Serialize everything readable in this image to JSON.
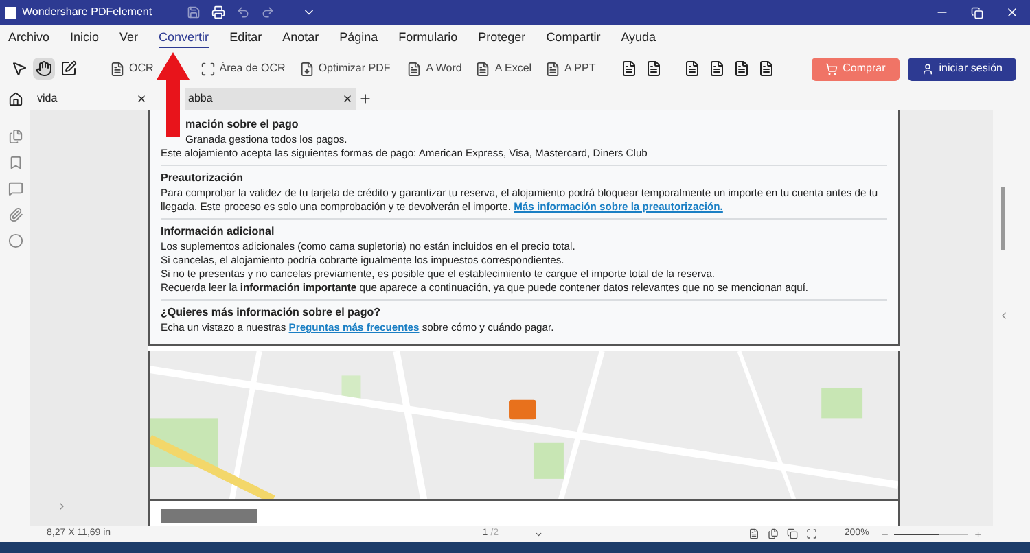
{
  "window": {
    "title": "Wondershare PDFelement"
  },
  "menu": [
    {
      "label": "Archivo",
      "selected": false
    },
    {
      "label": "Inicio",
      "selected": false
    },
    {
      "label": "Ver",
      "selected": false
    },
    {
      "label": "Convertir",
      "selected": true
    },
    {
      "label": "Editar",
      "selected": false
    },
    {
      "label": "Anotar",
      "selected": false
    },
    {
      "label": "Página",
      "selected": false
    },
    {
      "label": "Formulario",
      "selected": false
    },
    {
      "label": "Proteger",
      "selected": false
    },
    {
      "label": "Compartir",
      "selected": false
    },
    {
      "label": "Ayuda",
      "selected": false
    }
  ],
  "tools": [
    {
      "kind": "select",
      "selected": false
    },
    {
      "kind": "hand",
      "selected": true
    },
    {
      "kind": "edit",
      "selected": false
    }
  ],
  "actions": [
    {
      "kind": "ocr",
      "label": "OCR"
    },
    {
      "kind": "area",
      "label": "Área de OCR"
    },
    {
      "kind": "optimize",
      "label": "Optimizar PDF"
    },
    {
      "kind": "word",
      "label": "A Word"
    },
    {
      "kind": "excel",
      "label": "A Excel"
    },
    {
      "kind": "ppt",
      "label": "A PPT"
    }
  ],
  "buttons": {
    "buy": "Comprar",
    "login": "iniciar sesión"
  },
  "tabs": [
    {
      "label": "vida",
      "selected": false
    },
    {
      "label": "abba",
      "selected": true
    }
  ],
  "document": {
    "sections": [
      {
        "heading": "mación sobre el pago",
        "paragraphs": [
          [
            {
              "kind": "text",
              "text": "Granada gestiona todos los pagos."
            }
          ],
          [
            {
              "kind": "text",
              "text": "Este alojamiento acepta las siguientes formas de pago: American Express, Visa, Mastercard, Diners Club"
            }
          ]
        ]
      },
      {
        "heading": "Preautorización",
        "paragraphs": [
          [
            {
              "kind": "text",
              "text": "Para comprobar la validez de tu tarjeta de crédito y garantizar tu reserva, el alojamiento podrá bloquear temporalmente un importe en tu cuenta antes de tu llegada. Este proceso es solo una comprobación y te devolverán el importe. "
            },
            {
              "kind": "link",
              "text": "Más información sobre la preautorización."
            }
          ]
        ]
      },
      {
        "heading": "Información adicional",
        "paragraphs": [
          [
            {
              "kind": "text",
              "text": "Los suplementos adicionales (como cama supletoria) no están incluidos en el precio total."
            }
          ],
          [
            {
              "kind": "text",
              "text": "Si cancelas, el alojamiento podría cobrarte igualmente los impuestos correspondientes."
            }
          ],
          [
            {
              "kind": "text",
              "text": "Si no te presentas y no cancelas previamente, es posible que el establecimiento te cargue el importe total de la reserva."
            }
          ],
          [
            {
              "kind": "text",
              "text": "Recuerda leer la **información importante** que aparece a continuación, ya que puede contener datos relevantes que no se mencionan aquí."
            }
          ]
        ]
      },
      {
        "heading": "¿Quieres más información sobre el pago?",
        "paragraphs": [
          [
            {
              "kind": "text",
              "text": "Echa un vistazo a nuestras "
            },
            {
              "kind": "link",
              "text": "Preguntas más frecuentes"
            },
            {
              "kind": "text",
              "text": " sobre cómo y cuándo pagar."
            }
          ]
        ]
      }
    ]
  },
  "status": {
    "page_size": "8,27 X 11,69 in",
    "page": "1",
    "page_total": "/2",
    "zoom": "200%",
    "zoom_slider": {
      "level": 0.6
    }
  }
}
